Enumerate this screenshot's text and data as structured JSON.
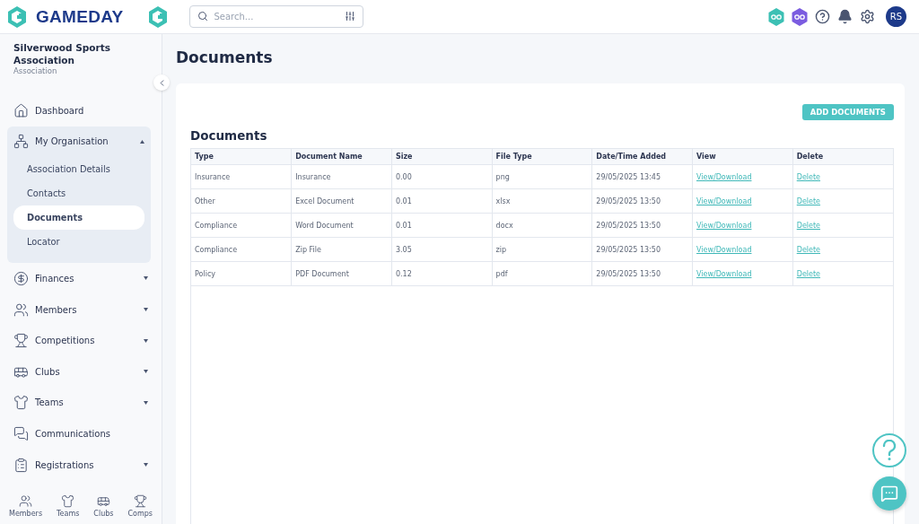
{
  "header": {
    "brand": "GAMEDAY",
    "search": {
      "placeholder": "Search..."
    },
    "avatar": "RS"
  },
  "sidebar": {
    "org_name": "Silverwood Sports Association",
    "org_type": "Association",
    "items": [
      {
        "label": "Dashboard"
      },
      {
        "label": "My Organisation",
        "expanded": true,
        "children": [
          {
            "label": "Association Details",
            "selected": false
          },
          {
            "label": "Contacts",
            "selected": false
          },
          {
            "label": "Documents",
            "selected": true
          },
          {
            "label": "Locator",
            "selected": false
          }
        ]
      },
      {
        "label": "Finances",
        "expanded": false
      },
      {
        "label": "Members",
        "expanded": false
      },
      {
        "label": "Competitions",
        "expanded": false
      },
      {
        "label": "Clubs",
        "expanded": false
      },
      {
        "label": "Teams",
        "expanded": false
      },
      {
        "label": "Communications"
      },
      {
        "label": "Registrations",
        "expanded": false
      }
    ],
    "bottom_nav": [
      {
        "label": "Members"
      },
      {
        "label": "Teams"
      },
      {
        "label": "Clubs"
      },
      {
        "label": "Comps"
      }
    ]
  },
  "page": {
    "title": "Documents",
    "add_button": "ADD DOCUMENTS",
    "section_title": "Documents",
    "table": {
      "columns": [
        "Type",
        "Document Name",
        "Size",
        "File Type",
        "Date/Time Added",
        "View",
        "Delete"
      ],
      "rows": [
        {
          "type": "Insurance",
          "name": "Insurance",
          "size": "0.00",
          "file_type": "png",
          "added": "29/05/2025 13:45",
          "view": "View/Download",
          "delete": "Delete"
        },
        {
          "type": "Other",
          "name": "Excel Document",
          "size": "0.01",
          "file_type": "xlsx",
          "added": "29/05/2025 13:50",
          "view": "View/Download",
          "delete": "Delete"
        },
        {
          "type": "Compliance",
          "name": "Word Document",
          "size": "0.01",
          "file_type": "docx",
          "added": "29/05/2025 13:50",
          "view": "View/Download",
          "delete": "Delete"
        },
        {
          "type": "Compliance",
          "name": "Zip File",
          "size": "3.05",
          "file_type": "zip",
          "added": "29/05/2025 13:50",
          "view": "View/Download",
          "delete": "Delete"
        },
        {
          "type": "Policy",
          "name": "PDF Document",
          "size": "0.12",
          "file_type": "pdf",
          "added": "29/05/2025 13:50",
          "view": "View/Download",
          "delete": "Delete"
        }
      ]
    }
  }
}
